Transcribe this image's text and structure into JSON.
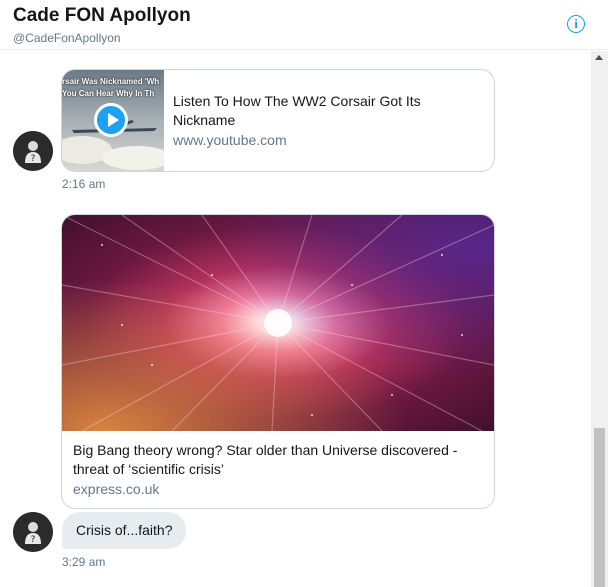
{
  "header": {
    "name": "Cade FON Apollyon",
    "handle": "@CadeFonApollyon",
    "info_icon": "info-icon"
  },
  "messages": [
    {
      "type": "link-card",
      "thumbnail_text_line1": "rsair Was Nicknamed 'Wh",
      "thumbnail_text_line2": "You Can Hear Why In Th",
      "title": "Listen To How The WW2 Corsair Got Its Nickname",
      "domain": "www.youtube.com",
      "time": "2:16 am"
    },
    {
      "type": "link-card",
      "title": "Big Bang theory wrong? Star older than Universe discovered - threat of ‘scientific crisis’",
      "domain": "express.co.uk"
    },
    {
      "type": "text",
      "text": "Crisis of...faith?",
      "time": "3:29 am"
    }
  ],
  "colors": {
    "accent": "#1da1f2",
    "muted": "#657786",
    "bubble": "#e6ecf0",
    "border": "#ccd6dd"
  }
}
